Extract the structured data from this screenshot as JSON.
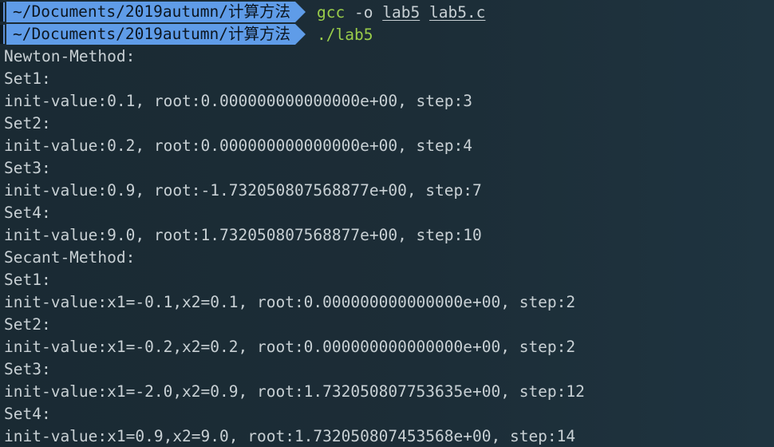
{
  "prompt": {
    "path": "~/Documents/2019autumn/计算方法"
  },
  "commands": [
    {
      "program": "gcc",
      "flag": "-o",
      "arg1": "lab5",
      "arg2": "lab5.c"
    },
    {
      "program": "./lab5"
    }
  ],
  "output": [
    "Newton-Method:",
    "Set1:",
    "init-value:0.1, root:0.000000000000000e+00, step:3",
    "Set2:",
    "init-value:0.2, root:0.000000000000000e+00, step:4",
    "Set3:",
    "init-value:0.9, root:-1.732050807568877e+00, step:7",
    "Set4:",
    "init-value:9.0, root:1.732050807568877e+00, step:10",
    "Secant-Method:",
    "Set1:",
    "init-value:x1=-0.1,x2=0.1, root:0.000000000000000e+00, step:2",
    "Set2:",
    "init-value:x1=-0.2,x2=0.2, root:0.000000000000000e+00, step:2",
    "Set3:",
    "init-value:x1=-2.0,x2=0.9, root:1.732050807753635e+00, step:12",
    "Set4:",
    "init-value:x1=0.9,x2=9.0, root:1.732050807453568e+00, step:14"
  ],
  "colors": {
    "background": "#1b2b34",
    "prompt_bg": "#5f9ce8",
    "command": "#9acd4a",
    "text": "#c8d0d4"
  }
}
